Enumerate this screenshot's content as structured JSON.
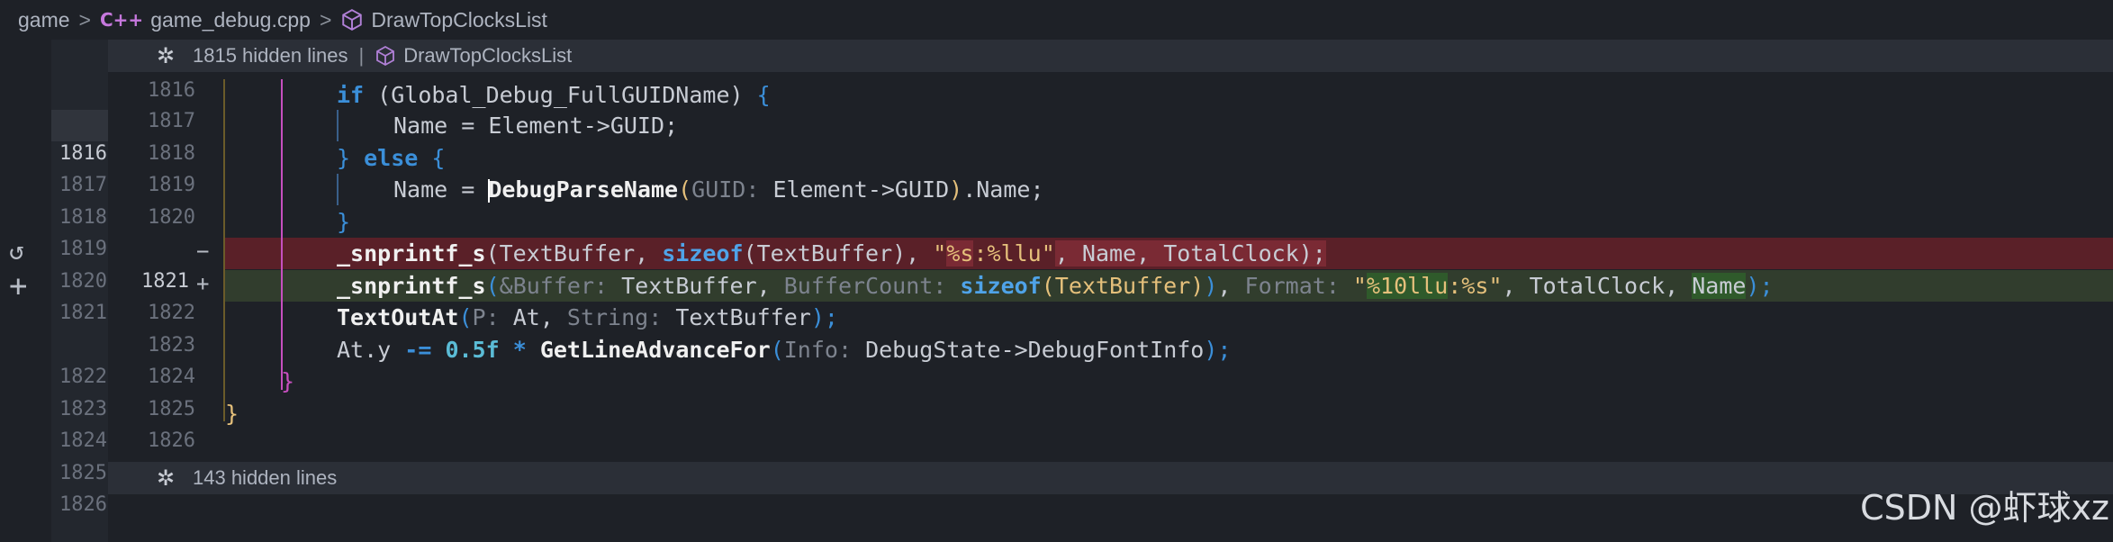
{
  "breadcrumb": {
    "folder": "game",
    "file_icon": "C++",
    "file": "game_debug.cpp",
    "symbol": "DrawTopClocksList",
    "separator": ">"
  },
  "hidden_top": {
    "text": "1815 hidden lines",
    "divider": "|",
    "symbol": "DrawTopClocksList",
    "icon": "unfold-icon"
  },
  "hidden_bottom": {
    "text": "143 hidden lines",
    "icon": "unfold-icon"
  },
  "old_line_numbers": [
    "1816",
    "1817",
    "1818",
    "1819",
    "1820",
    "1821",
    "1822",
    "1823",
    "1824",
    "1825",
    "1826"
  ],
  "new_line_numbers": [
    "1816",
    "1817",
    "1818",
    "1819",
    "1820",
    "1821",
    "1822",
    "1823",
    "1824",
    "1825",
    "1826"
  ],
  "diff_markers": {
    "deleted": "−",
    "added": "+"
  },
  "code": {
    "l1": {
      "kw": "if",
      "p1": " (Global_Debug_FullGUIDName) ",
      "brace": "{"
    },
    "l2": {
      "text": "Name = Element->GUID;"
    },
    "l3": {
      "brace1": "}",
      "kw": " else ",
      "brace2": "{"
    },
    "l4": {
      "pre": "Name = ",
      "fn": "DebugParseName",
      "open": "(",
      "hint": "GUID:",
      "arg": " Element->GUID",
      "close": ")",
      "post": ".Name;"
    },
    "l5": {
      "brace": "}"
    },
    "del": {
      "fn": "_snprintf_s",
      "p1": "(TextBuffer, ",
      "kw": "sizeof",
      "p2": "(TextBuffer), ",
      "q1": "\"",
      "s1": "%s",
      "s2": ":",
      "s3": "%llu",
      "q2": "\"",
      "p3": ", Name, TotalClock);"
    },
    "add": {
      "fn": "_snprintf_s",
      "open": "(",
      "h1": "&Buffer:",
      "a1": " TextBuffer, ",
      "h2": "BufferCount:",
      "kw": " sizeof",
      "a2": "(TextBuffer)",
      "close1": ")",
      "comma": ", ",
      "h3": "Format:",
      "q1": " \"",
      "s1": "%10llu",
      "s2": ":",
      "s3": "%s",
      "q2": "\"",
      "a3": ", TotalClock, ",
      "a4": "Name",
      "end": ");"
    },
    "l8": {
      "fn": "TextOutAt",
      "open": "(",
      "h1": "P:",
      "a1": " At, ",
      "h2": "String:",
      "a2": " TextBuffer",
      "end": ");"
    },
    "l9": {
      "pre": "At.y ",
      "op": "-=",
      "sp": " ",
      "num": "0.5f",
      "mul": " * ",
      "fn": "GetLineAdvanceFor",
      "open": "(",
      "hint": "Info:",
      "arg": " DebugState->DebugFontInfo",
      "end": ");"
    },
    "l10": {
      "brace": "}"
    },
    "l11": {
      "brace": "}"
    }
  },
  "watermark": "CSDN @虾球xz",
  "colors": {
    "deleted_bg": "#5a2028",
    "added_bg": "#313d2d",
    "keyword": "#3b8fd9",
    "string": "#e5c07b",
    "number": "#5bbcd6"
  }
}
